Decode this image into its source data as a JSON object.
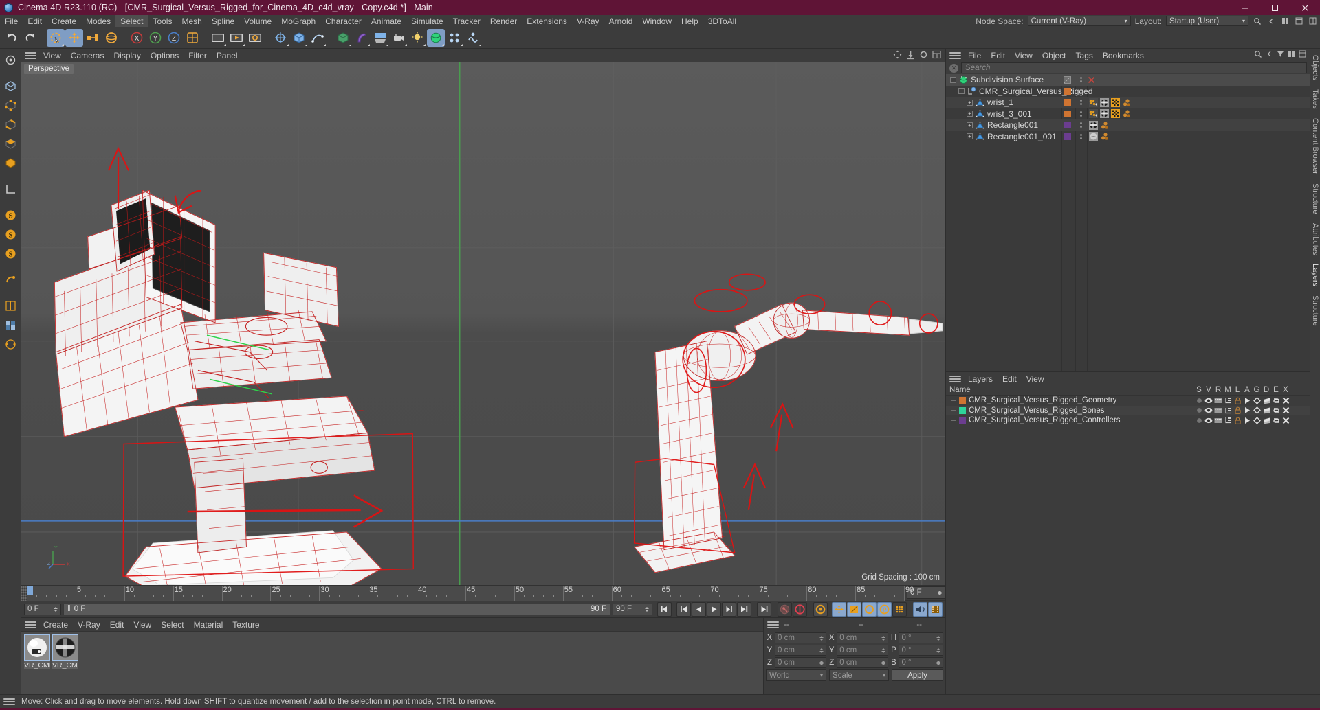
{
  "window": {
    "title": "Cinema 4D R23.110 (RC) - [CMR_Surgical_Versus_Rigged_for_Cinema_4D_c4d_vray - Copy.c4d *] - Main",
    "logo_icon": "cinema4d-logo-icon",
    "minimize_icon": "minimize-icon",
    "maximize_icon": "maximize-icon",
    "close_icon": "close-icon",
    "titlebar_color": "#5f1436"
  },
  "menubar": {
    "items": [
      "File",
      "Edit",
      "Create",
      "Modes",
      "Select",
      "Tools",
      "Mesh",
      "Spline",
      "Volume",
      "MoGraph",
      "Character",
      "Animate",
      "Simulate",
      "Tracker",
      "Render",
      "Extensions",
      "V-Ray",
      "Arnold",
      "Window",
      "Help",
      "3DToAll"
    ],
    "active_item": "Select",
    "node_space_label": "Node Space:",
    "node_space_value": "Current (V-Ray)",
    "layout_label": "Layout:",
    "layout_value": "Startup (User)",
    "search_icon": "search-icon",
    "extra_icons": [
      "chevron-left-icon",
      "grid-icon",
      "window-icon",
      "panel-icon"
    ]
  },
  "toolbar": {
    "buttons": [
      {
        "name": "undo-button",
        "icon": "undo-arrow-icon"
      },
      {
        "name": "redo-button",
        "icon": "redo-arrow-icon"
      },
      {
        "name": "live-selection-button",
        "icon": "lasso-select-icon",
        "active": true
      },
      {
        "name": "move-button",
        "icon": "move-cross-icon",
        "active": true
      },
      {
        "name": "scale-button",
        "icon": "scale-icon"
      },
      {
        "name": "rotate-button",
        "icon": "rotate-icon"
      },
      {
        "name": "x-axis-lock-button",
        "icon": "x-axis-icon"
      },
      {
        "name": "y-axis-lock-button",
        "icon": "y-axis-icon"
      },
      {
        "name": "z-axis-lock-button",
        "icon": "z-axis-icon"
      },
      {
        "name": "world-object-coordinates-button",
        "icon": "world-axis-icon"
      },
      {
        "name": "render-view-button",
        "icon": "render-frame-icon"
      },
      {
        "name": "render-region-button",
        "icon": "render-play-icon"
      },
      {
        "name": "render-settings-button",
        "icon": "render-settings-icon"
      },
      {
        "name": "null-object-button",
        "icon": "null-object-icon"
      },
      {
        "name": "primitive-cube-button",
        "icon": "cube-icon"
      },
      {
        "name": "spline-pen-button",
        "icon": "pen-spline-icon"
      },
      {
        "name": "generator-button",
        "icon": "generator-cube-icon"
      },
      {
        "name": "deformer-button",
        "icon": "bend-deformer-icon"
      },
      {
        "name": "environment-button",
        "icon": "floor-sky-icon"
      },
      {
        "name": "camera-button",
        "icon": "camera-icon"
      },
      {
        "name": "light-button",
        "icon": "light-bulb-icon"
      },
      {
        "name": "subdivision-surface-button",
        "icon": "subdivision-icon",
        "active": true
      },
      {
        "name": "mograph-button",
        "icon": "mograph-icon"
      },
      {
        "name": "simulate-button",
        "icon": "simulation-icon"
      }
    ]
  },
  "left_toolbar": {
    "buttons": [
      {
        "name": "model-mode-button",
        "icon": "model-mode-icon"
      },
      {
        "name": "object-mode-button",
        "icon": "object-axis-icon"
      },
      {
        "name": "point-mode-button",
        "icon": "point-mode-icon"
      },
      {
        "name": "edge-mode-button",
        "icon": "edge-mode-icon"
      },
      {
        "name": "polygon-mode-button",
        "icon": "polygon-mode-icon"
      },
      {
        "name": "texture-mode-button",
        "icon": "texture-mode-icon"
      },
      {
        "name": "workplane-mode-button",
        "icon": "workplane-icon"
      },
      {
        "name": "enable-axis-modification-button",
        "icon": "axis-s-icon"
      },
      {
        "name": "lock-workplane-button",
        "icon": "lock-s-icon"
      },
      {
        "name": "snap-mode-button",
        "icon": "snap-s-icon"
      },
      {
        "name": "viewport-solo-button",
        "icon": "solo-icon"
      },
      {
        "name": "uv-mesh-button",
        "icon": "uv-mesh-icon"
      },
      {
        "name": "uv-polygons-button",
        "icon": "uv-polygons-icon"
      },
      {
        "name": "uv-points-button",
        "icon": "uv-points-icon"
      }
    ]
  },
  "viewport": {
    "menu_items": [
      "View",
      "Cameras",
      "Display",
      "Options",
      "Filter",
      "Panel"
    ],
    "hamburger_icon": "hamburger-menu-icon",
    "view_label": "Perspective",
    "grid_spacing": "Grid Spacing : 100 cm",
    "corner_icons": [
      "move-view-icon",
      "pan-view-icon",
      "rotate-view-icon",
      "maximize-view-icon"
    ],
    "axis_labels": {
      "y": "Y",
      "x": "X",
      "z": "Z"
    }
  },
  "timeline": {
    "ticks": [
      0,
      5,
      10,
      15,
      20,
      25,
      30,
      35,
      40,
      45,
      50,
      55,
      60,
      65,
      70,
      75,
      80,
      85,
      90
    ],
    "min_frame": 0,
    "max_frame": 90,
    "playhead_frame": 0,
    "end_field_value": "0 F",
    "current_frame_value": "0 F",
    "track_start_value": "0 F",
    "track_end_value": "90 F",
    "range_end_value": "90 F"
  },
  "transport": {
    "buttons": [
      {
        "name": "go-to-start-button",
        "icon": "skip-start-icon"
      },
      {
        "name": "go-to-previous-keyframe-button",
        "icon": "prev-key-icon"
      },
      {
        "name": "step-back-button",
        "icon": "step-back-icon"
      },
      {
        "name": "play-button",
        "icon": "play-icon"
      },
      {
        "name": "step-forward-button",
        "icon": "step-forward-icon"
      },
      {
        "name": "go-to-next-keyframe-button",
        "icon": "next-key-icon"
      },
      {
        "name": "go-to-end-button",
        "icon": "skip-end-icon"
      },
      {
        "name": "record-active-objects-button",
        "icon": "record-key-icon"
      },
      {
        "name": "autokeying-button",
        "icon": "autokey-icon"
      },
      {
        "name": "keyframe-selection-button",
        "icon": "keyframe-gear-icon"
      },
      {
        "name": "record-position-button",
        "icon": "position-cross-icon",
        "active": true
      },
      {
        "name": "record-scale-button",
        "icon": "scale-square-icon",
        "active": true
      },
      {
        "name": "record-rotation-button",
        "icon": "rotation-circle-icon",
        "active": true
      },
      {
        "name": "record-pla-button",
        "icon": "pla-circle-icon",
        "active": true
      },
      {
        "name": "record-parameter-button",
        "icon": "dots-grid-icon"
      },
      {
        "name": "sound-button",
        "icon": "speaker-icon",
        "active": true
      },
      {
        "name": "film-button",
        "icon": "film-strip-icon",
        "active": true
      }
    ]
  },
  "material_manager": {
    "menu_items": [
      "Create",
      "V-Ray",
      "Edit",
      "View",
      "Select",
      "Material",
      "Texture"
    ],
    "hamburger_icon": "hamburger-menu-icon",
    "materials": [
      {
        "name": "VR_CMR",
        "selected": true,
        "swatch_kind": "white-plastic-preview"
      },
      {
        "name": "VR_CMR",
        "selected": true,
        "swatch_kind": "dark-checker-preview"
      }
    ]
  },
  "coordinates": {
    "hamburger_icon": "hamburger-menu-icon",
    "headers": [
      "--",
      "--",
      "--"
    ],
    "rows": [
      {
        "label_pos": "X",
        "value_pos": "0 cm",
        "label_size": "X",
        "value_size": "0 cm",
        "label_rot": "H",
        "value_rot": "0 °"
      },
      {
        "label_pos": "Y",
        "value_pos": "0 cm",
        "label_size": "Y",
        "value_size": "0 cm",
        "label_rot": "P",
        "value_rot": "0 °"
      },
      {
        "label_pos": "Z",
        "value_pos": "0 cm",
        "label_size": "Z",
        "value_size": "0 cm",
        "label_rot": "B",
        "value_rot": "0 °"
      }
    ],
    "system_value": "World",
    "mode_value": "Scale",
    "apply_label": "Apply"
  },
  "object_manager": {
    "hamburger_icon": "hamburger-menu-icon",
    "menu_items": [
      "File",
      "Edit",
      "View",
      "Object",
      "Tags",
      "Bookmarks"
    ],
    "right_icons": [
      "search-icon",
      "chevron-left-icon",
      "filter-icon",
      "grid-icon",
      "panel-icon"
    ],
    "search_placeholder": "Search",
    "search_clear_icon": "clear-search-icon",
    "items": [
      {
        "label": "Subdivision Surface",
        "depth": 0,
        "icon": "subdivision-surface-icon",
        "icon_color": "#2fd37a",
        "expander": "minus",
        "layer_chip": null,
        "visibility_dots": true,
        "extra": "enabled-check-and-x",
        "tags": []
      },
      {
        "label": "CMR_Surgical_Versus_Rigged",
        "depth": 1,
        "icon": "null-object-icon",
        "icon_color": "#7fb3e8",
        "expander": "minus",
        "layer_chip": "#cf7432",
        "visibility_dots": true,
        "tags": []
      },
      {
        "label": "wrist_1",
        "depth": 2,
        "icon": "polygon-object-icon",
        "icon_color": "#4a9ae0",
        "expander": "plus",
        "layer_chip": "#cf7432",
        "visibility_dots": true,
        "tags": [
          "weight-tag-icon",
          "material-tag-icon",
          "uvw-tag-icon",
          "point-cache-tag-icon"
        ]
      },
      {
        "label": "wrist_3_001",
        "depth": 2,
        "icon": "polygon-object-icon",
        "icon_color": "#4a9ae0",
        "expander": "plus",
        "layer_chip": "#cf7432",
        "visibility_dots": true,
        "tags": [
          "weight-tag-icon",
          "material-tag-icon",
          "uvw-tag-icon",
          "point-cache-tag-icon"
        ]
      },
      {
        "label": "Rectangle001",
        "depth": 2,
        "icon": "polygon-object-icon",
        "icon_color": "#4a9ae0",
        "expander": "plus",
        "layer_chip": "#6b3d8f",
        "visibility_dots": true,
        "tags": [
          "material-tag-icon",
          "point-cache-tag-icon"
        ]
      },
      {
        "label": "Rectangle001_001",
        "depth": 2,
        "icon": "polygon-object-icon",
        "icon_color": "#4a9ae0",
        "expander": "plus",
        "layer_chip": "#6b3d8f",
        "visibility_dots": true,
        "tags": [
          "grey-material-tag-icon",
          "point-cache-tag-icon"
        ]
      }
    ]
  },
  "layer_manager": {
    "hamburger_icon": "hamburger-menu-icon",
    "menu_items": [
      "Layers",
      "Edit",
      "View"
    ],
    "name_header": "Name",
    "flag_headers": [
      "S",
      "V",
      "R",
      "M",
      "L",
      "A",
      "G",
      "D",
      "E",
      "X"
    ],
    "layers": [
      {
        "name": "CMR_Surgical_Versus_Rigged_Geometry",
        "color": "#cf7432"
      },
      {
        "name": "CMR_Surgical_Versus_Rigged_Bones",
        "color": "#2fd39a"
      },
      {
        "name": "CMR_Surgical_Versus_Rigged_Controllers",
        "color": "#6b3d8f"
      }
    ],
    "flag_icons": [
      "solo-dot-icon",
      "eye-icon",
      "render-icon",
      "manager-icon",
      "lock-icon",
      "animation-icon",
      "generator-icon",
      "deformer-icon",
      "expression-icon",
      "xpresso-icon"
    ]
  },
  "right_tabs": {
    "items": [
      "Objects",
      "Takes",
      "Content Browser",
      "Structure",
      "Attributes",
      "Layers",
      "Structure"
    ],
    "active": "Layers"
  },
  "statusbar": {
    "hamburger_icon": "hamburger-menu-icon",
    "message": "Move: Click and drag to move elements. Hold down SHIFT to quantize movement / add to the selection in point mode, CTRL to remove."
  },
  "scene": {
    "wireframe_color": "#c41a1a",
    "mesh_color": "#f2f2f2",
    "description": "Surgical robot console and robotic arm, rigged wireframe preview"
  }
}
